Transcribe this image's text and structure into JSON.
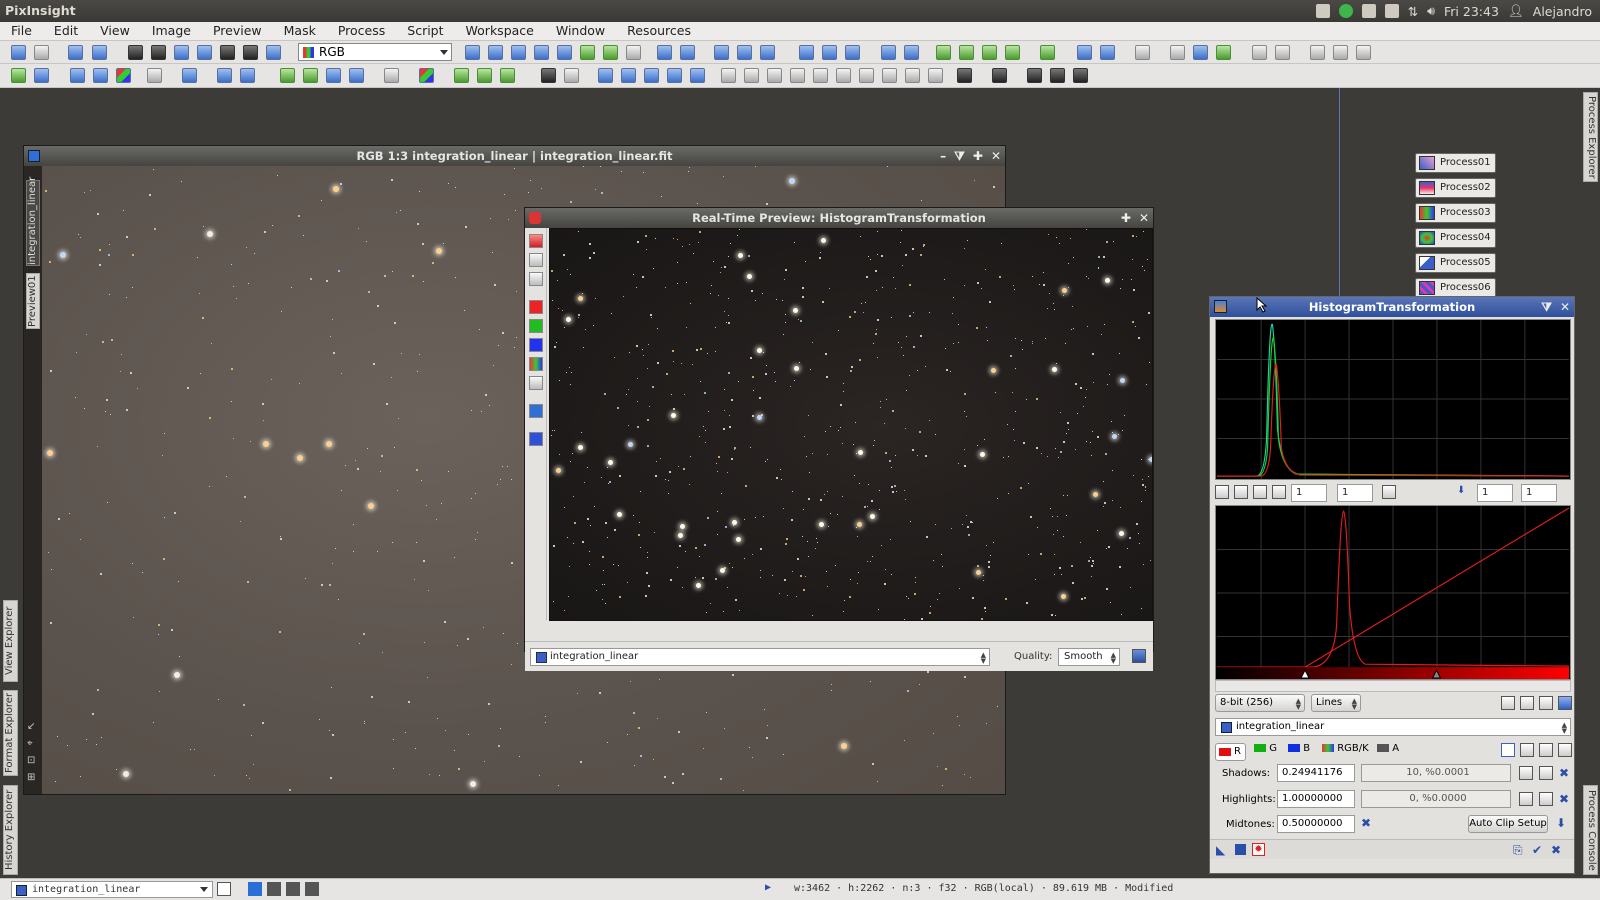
{
  "app": {
    "title": "PixInsight"
  },
  "tray": {
    "clock": "Fri 23:43",
    "user": "Alejandro"
  },
  "menu": [
    "File",
    "Edit",
    "View",
    "Image",
    "Preview",
    "Mask",
    "Process",
    "Script",
    "Workspace",
    "Window",
    "Resources"
  ],
  "toolbar": {
    "channel_select": "RGB"
  },
  "main_window": {
    "title": "RGB 1:3 integration_linear | integration_linear.fit",
    "side_tabs": [
      "integration_linear",
      "Preview01"
    ]
  },
  "preview_window": {
    "title": "Real-Time Preview: HistogramTransformation",
    "view_select": "integration_linear",
    "quality_label": "Quality:",
    "quality_value": "Smooth"
  },
  "process_icons": [
    "Process01",
    "Process02",
    "Process03",
    "Process04",
    "Process05",
    "Process06"
  ],
  "histogram": {
    "title": "HistogramTransformation",
    "zoom_x": "1",
    "zoom_y": "1",
    "zoom_x2": "1",
    "zoom_y2": "1",
    "resolution": "8-bit (256)",
    "graph_style": "Lines",
    "view": "integration_linear",
    "channels": [
      {
        "label": "R",
        "color": "#e01010"
      },
      {
        "label": "G",
        "color": "#10b010"
      },
      {
        "label": "B",
        "color": "#1030e0"
      },
      {
        "label": "RGB/K",
        "color": "#333333"
      },
      {
        "label": "A",
        "color": "#555555"
      }
    ],
    "shadows_label": "Shadows:",
    "shadows_value": "0.24941176",
    "shadows_clip": "10, %0.0001",
    "highlights_label": "Highlights:",
    "highlights_value": "1.00000000",
    "highlights_clip": "0, %0.0000",
    "midtones_label": "Midtones:",
    "midtones_value": "0.50000000",
    "auto_clip": "Auto Clip Setup"
  },
  "left_dock": [
    "View Explorer",
    "Format Explorer",
    "History Explorer"
  ],
  "right_dock": [
    "Process Explorer",
    "Process Console"
  ],
  "status": {
    "view": "integration_linear",
    "info": "w:3462 · h:2262 · n:3 · f32 · RGB(local) · 89.619 MB · Modified"
  },
  "colors": {
    "title_active": "#3b5ba8",
    "workspace": "#3c3b37"
  }
}
